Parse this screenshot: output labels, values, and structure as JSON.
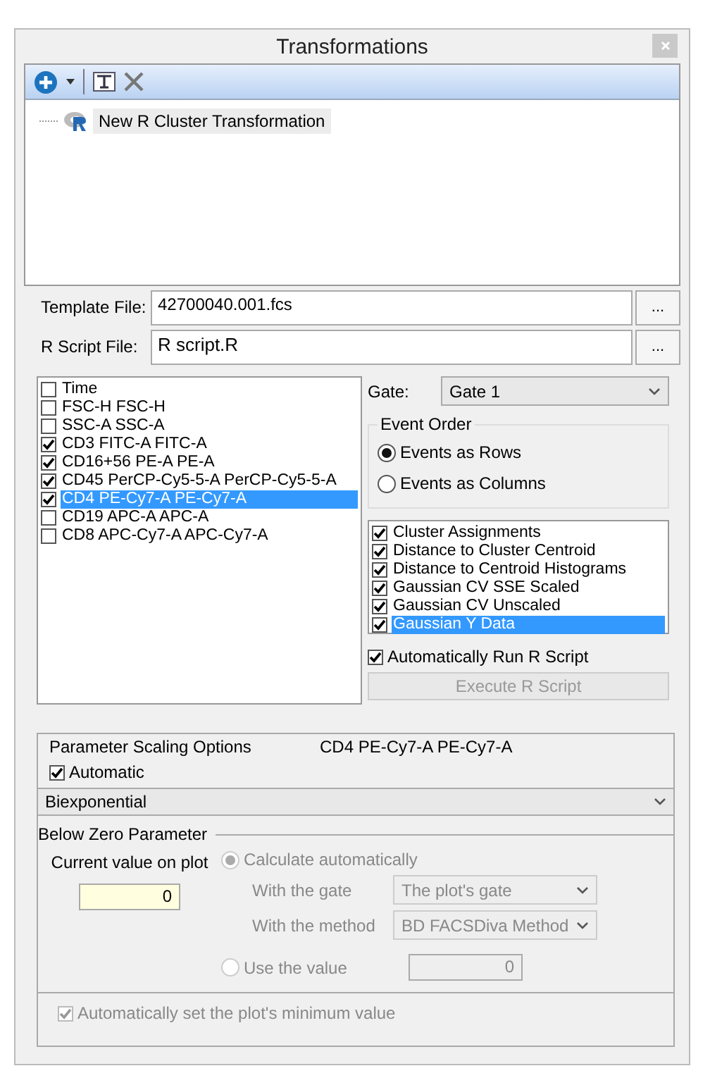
{
  "window": {
    "title": "Transformations"
  },
  "tree": {
    "items": [
      {
        "label": "New R Cluster Transformation",
        "selected": true
      }
    ]
  },
  "files": [
    {
      "label": "Template File:",
      "value": "42700040.001.fcs",
      "browse": "..."
    },
    {
      "label": "R Script File:",
      "value": "R script.R",
      "browse": "..."
    }
  ],
  "parameters": [
    {
      "label": "Time",
      "checked": false,
      "selected": false
    },
    {
      "label": "FSC-H FSC-H",
      "checked": false,
      "selected": false
    },
    {
      "label": "SSC-A SSC-A",
      "checked": false,
      "selected": false
    },
    {
      "label": "CD3 FITC-A FITC-A",
      "checked": true,
      "selected": false
    },
    {
      "label": "CD16+56 PE-A PE-A",
      "checked": true,
      "selected": false
    },
    {
      "label": "CD45 PerCP-Cy5-5-A PerCP-Cy5-5-A",
      "checked": true,
      "selected": false
    },
    {
      "label": "CD4 PE-Cy7-A PE-Cy7-A",
      "checked": true,
      "selected": true
    },
    {
      "label": "CD19 APC-A APC-A",
      "checked": false,
      "selected": false
    },
    {
      "label": "CD8 APC-Cy7-A APC-Cy7-A",
      "checked": false,
      "selected": false
    }
  ],
  "gate": {
    "label": "Gate:",
    "value": "Gate 1"
  },
  "event_order": {
    "title": "Event Order",
    "options": [
      {
        "label": "Events as Rows",
        "selected": true
      },
      {
        "label": "Events as Columns",
        "selected": false
      }
    ]
  },
  "outputs": [
    {
      "label": "Cluster Assignments",
      "checked": true,
      "selected": false
    },
    {
      "label": "Distance to Cluster Centroid",
      "checked": true,
      "selected": false
    },
    {
      "label": "Distance to Centroid Histograms",
      "checked": true,
      "selected": false
    },
    {
      "label": "Gaussian CV SSE Scaled",
      "checked": true,
      "selected": false
    },
    {
      "label": "Gaussian CV Unscaled",
      "checked": true,
      "selected": false
    },
    {
      "label": "Gaussian Y Data",
      "checked": true,
      "selected": true
    }
  ],
  "auto_run": {
    "label": "Automatically Run R Script",
    "checked": true
  },
  "execute_button": {
    "label": "Execute R Script",
    "disabled": true
  },
  "scaling": {
    "title": "Parameter Scaling Options",
    "parameter": "CD4 PE-Cy7-A PE-Cy7-A",
    "automatic": {
      "label": "Automatic",
      "checked": true
    },
    "scale_type": "Biexponential",
    "below_zero": {
      "title": "Below Zero Parameter",
      "current_label": "Current value on plot",
      "current_value": "0",
      "calculate": {
        "label": "Calculate automatically",
        "selected": true,
        "disabled": true
      },
      "gate_label": "With the gate",
      "gate_value": "The plot's gate",
      "method_label": "With the method",
      "method_value": "BD FACSDiva Method",
      "use_value": {
        "label": "Use the value",
        "selected": false,
        "disabled": true,
        "value": "0"
      }
    },
    "auto_min": {
      "label": "Automatically set the plot's minimum value",
      "checked": true,
      "disabled": true
    }
  }
}
